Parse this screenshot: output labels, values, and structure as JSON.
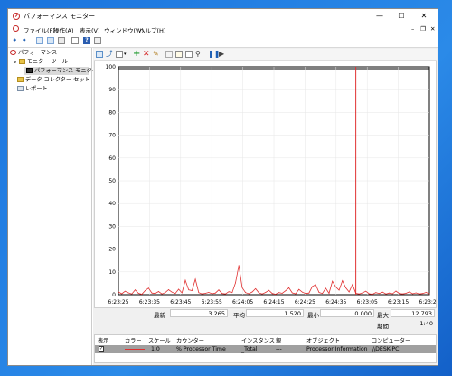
{
  "window": {
    "title": "パフォーマンス モニター",
    "controls": {
      "minimize": "—",
      "maximize": "☐",
      "close": "✕"
    }
  },
  "menu": {
    "items": [
      "ファイル(F)",
      "操作(A)",
      "表示(V)",
      "ウィンドウ(W)",
      "ヘルプ(H)"
    ],
    "mdi_controls": {
      "minimize": "–",
      "restore": "❐",
      "close": "✕"
    }
  },
  "tree": {
    "root": "パフォーマンス",
    "monitoring_tools": "モニター ツール",
    "perf_monitor": "パフォーマンス モニター",
    "data_collector_sets": "データ コレクター セット",
    "reports": "レポート"
  },
  "chart_data": {
    "type": "line",
    "ylim": [
      0,
      100
    ],
    "yticks": [
      "100",
      "90",
      "80",
      "70",
      "60",
      "50",
      "40",
      "30",
      "20",
      "10",
      "0"
    ],
    "xticks": [
      "6:23:25",
      "6:23:35",
      "6:23:45",
      "6:23:55",
      "6:24:05",
      "6:24:15",
      "6:24:25",
      "6:24:35",
      "6:23:05",
      "6:23:15",
      "6:23:24"
    ],
    "cursor_index": 71,
    "series": [
      {
        "color": "#e03030",
        "values": [
          1.2,
          0.4,
          1.5,
          0.8,
          0.3,
          2.1,
          0.6,
          0.2,
          1.8,
          2.9,
          0.7,
          0.5,
          1.4,
          0.3,
          0.9,
          2.2,
          1.1,
          0.5,
          2.4,
          0.8,
          6.3,
          2.1,
          1.8,
          6.8,
          0.9,
          0.3,
          0.6,
          1.0,
          0.4,
          0.7,
          2.1,
          0.5,
          0.3,
          1.3,
          0.9,
          5.2,
          12.8,
          3.1,
          0.9,
          0.4,
          1.2,
          2.6,
          0.8,
          0.3,
          1.0,
          1.9,
          0.5,
          0.2,
          0.9,
          0.6,
          1.7,
          3.0,
          0.8,
          0.4,
          2.3,
          1.1,
          0.5,
          0.7,
          3.6,
          4.4,
          1.0,
          0.5,
          2.8,
          0.6,
          5.9,
          3.4,
          2.0,
          6.1,
          3.0,
          1.2,
          4.5,
          0.6,
          0.3,
          0.8,
          1.5,
          0.4,
          0.2,
          0.9,
          0.5,
          1.1,
          0.3,
          0.7,
          0.4,
          1.6,
          0.5,
          0.3,
          0.6,
          1.2,
          0.4,
          0.8,
          0.3,
          0.5,
          1.0,
          0.4
        ]
      }
    ]
  },
  "stats": {
    "last_label": "最新",
    "last": "3.265",
    "avg_label": "平均",
    "avg": "1.520",
    "min_label": "最小",
    "min": "0.000",
    "max_label": "最大",
    "max": "12.793",
    "duration_label": "期間",
    "duration": "1:40"
  },
  "legend": {
    "headers": [
      "表示",
      "カラー",
      "スケール",
      "カウンター",
      "インスタンス",
      "親",
      "オブジェクト",
      "コンピューター"
    ],
    "row": {
      "checked": "✓",
      "scale": "1.0",
      "counter": "% Processor Time",
      "instance": "_Total",
      "parent": "---",
      "object": "Processor Information",
      "computer": "\\\\DESK-PC"
    }
  }
}
